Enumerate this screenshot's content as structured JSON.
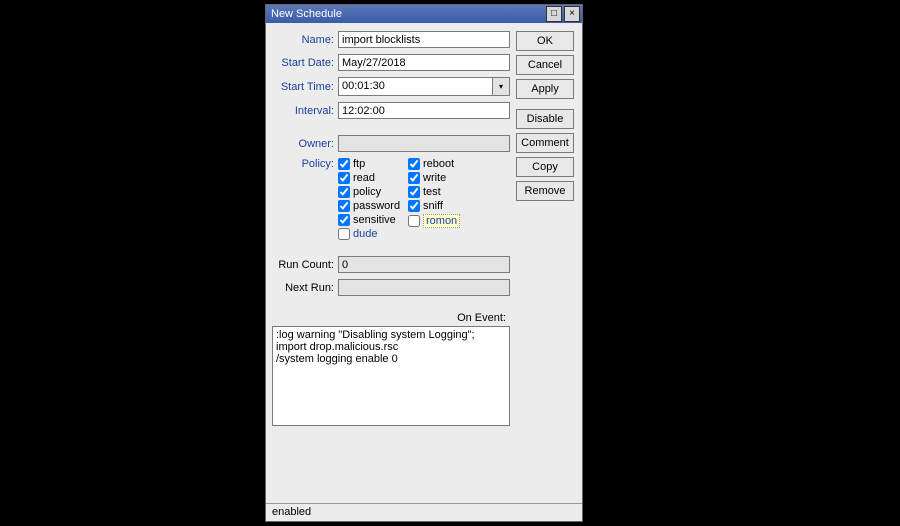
{
  "title": "New Schedule",
  "buttons": {
    "ok": "OK",
    "cancel": "Cancel",
    "apply": "Apply",
    "disable": "Disable",
    "comment": "Comment",
    "copy": "Copy",
    "remove": "Remove"
  },
  "labels": {
    "name": "Name:",
    "startDate": "Start Date:",
    "startTime": "Start Time:",
    "interval": "Interval:",
    "owner": "Owner:",
    "policy": "Policy:",
    "runCount": "Run Count:",
    "nextRun": "Next Run:",
    "onEvent": "On Event:"
  },
  "fields": {
    "name": "import blocklists",
    "startDate": "May/27/2018",
    "startTime": "00:01:30",
    "interval": "12:02:00",
    "owner": "",
    "runCount": "0",
    "nextRun": ""
  },
  "policy": {
    "left": [
      {
        "id": "ftp",
        "label": "ftp",
        "checked": true,
        "style": "normal"
      },
      {
        "id": "read",
        "label": "read",
        "checked": true,
        "style": "normal"
      },
      {
        "id": "policy",
        "label": "policy",
        "checked": true,
        "style": "normal"
      },
      {
        "id": "password",
        "label": "password",
        "checked": true,
        "style": "normal"
      },
      {
        "id": "sensitive",
        "label": "sensitive",
        "checked": true,
        "style": "normal"
      },
      {
        "id": "dude",
        "label": "dude",
        "checked": false,
        "style": "blue"
      }
    ],
    "right": [
      {
        "id": "reboot",
        "label": "reboot",
        "checked": true,
        "style": "normal"
      },
      {
        "id": "write",
        "label": "write",
        "checked": true,
        "style": "normal"
      },
      {
        "id": "test",
        "label": "test",
        "checked": true,
        "style": "normal"
      },
      {
        "id": "sniff",
        "label": "sniff",
        "checked": true,
        "style": "normal"
      },
      {
        "id": "romon",
        "label": "romon",
        "checked": false,
        "style": "hl"
      }
    ]
  },
  "script": ":log warning \"Disabling system Logging\";\nimport drop.malicious.rsc\n/system logging enable 0",
  "status": "enabled"
}
